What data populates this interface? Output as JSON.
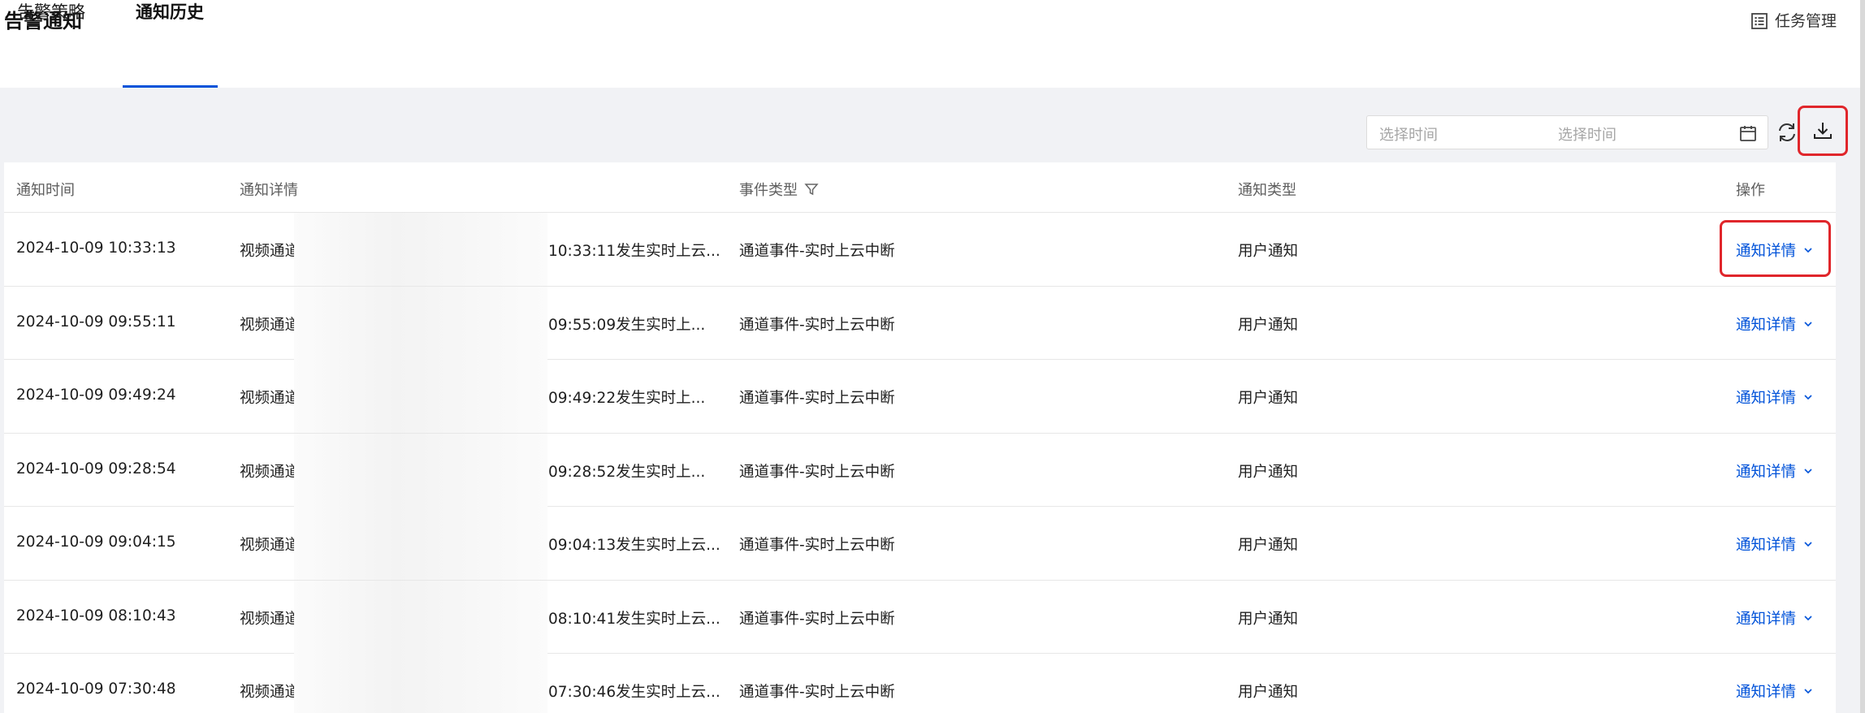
{
  "header": {
    "title": "告警通知",
    "task_management_label": "任务管理"
  },
  "tabs": [
    {
      "label": "告警策略",
      "active": false
    },
    {
      "label": "通知历史",
      "active": true
    }
  ],
  "toolbar": {
    "date_start_placeholder": "选择时间",
    "date_end_placeholder": "选择时间",
    "calendar_icon": "calendar-icon",
    "refresh_icon": "refresh-icon",
    "download_icon": "download-icon"
  },
  "table": {
    "columns": [
      "通知时间",
      "通知详情",
      "事件类型",
      "通知类型",
      "操作"
    ],
    "rows": [
      {
        "time": "2024-10-09 10:33:13",
        "detail_prefix": "视频通道",
        "detail_suffix": "10:33:11发生实时上云...",
        "event_type": "通道事件-实时上云中断",
        "notice_type": "用户通知",
        "action": "通知详情"
      },
      {
        "time": "2024-10-09 09:55:11",
        "detail_prefix": "视频通道",
        "detail_suffix": "09:55:09发生实时上...",
        "event_type": "通道事件-实时上云中断",
        "notice_type": "用户通知",
        "action": "通知详情"
      },
      {
        "time": "2024-10-09 09:49:24",
        "detail_prefix": "视频通道",
        "detail_suffix": "09:49:22发生实时上...",
        "event_type": "通道事件-实时上云中断",
        "notice_type": "用户通知",
        "action": "通知详情"
      },
      {
        "time": "2024-10-09 09:28:54",
        "detail_prefix": "视频通道",
        "detail_suffix": "09:28:52发生实时上...",
        "event_type": "通道事件-实时上云中断",
        "notice_type": "用户通知",
        "action": "通知详情"
      },
      {
        "time": "2024-10-09 09:04:15",
        "detail_prefix": "视频通道",
        "detail_suffix": "09:04:13发生实时上云...",
        "event_type": "通道事件-实时上云中断",
        "notice_type": "用户通知",
        "action": "通知详情"
      },
      {
        "time": "2024-10-09 08:10:43",
        "detail_prefix": "视频通道",
        "detail_suffix": "08:10:41发生实时上云...",
        "event_type": "通道事件-实时上云中断",
        "notice_type": "用户通知",
        "action": "通知详情"
      },
      {
        "time": "2024-10-09 07:30:48",
        "detail_prefix": "视频通道",
        "detail_suffix": "07:30:46发生实时上云...",
        "event_type": "通道事件-实时上云中断",
        "notice_type": "用户通知",
        "action": "通知详情"
      }
    ]
  },
  "colors": {
    "accent": "#0052d9",
    "highlight": "#e0262b",
    "background": "#f1f2f5"
  }
}
